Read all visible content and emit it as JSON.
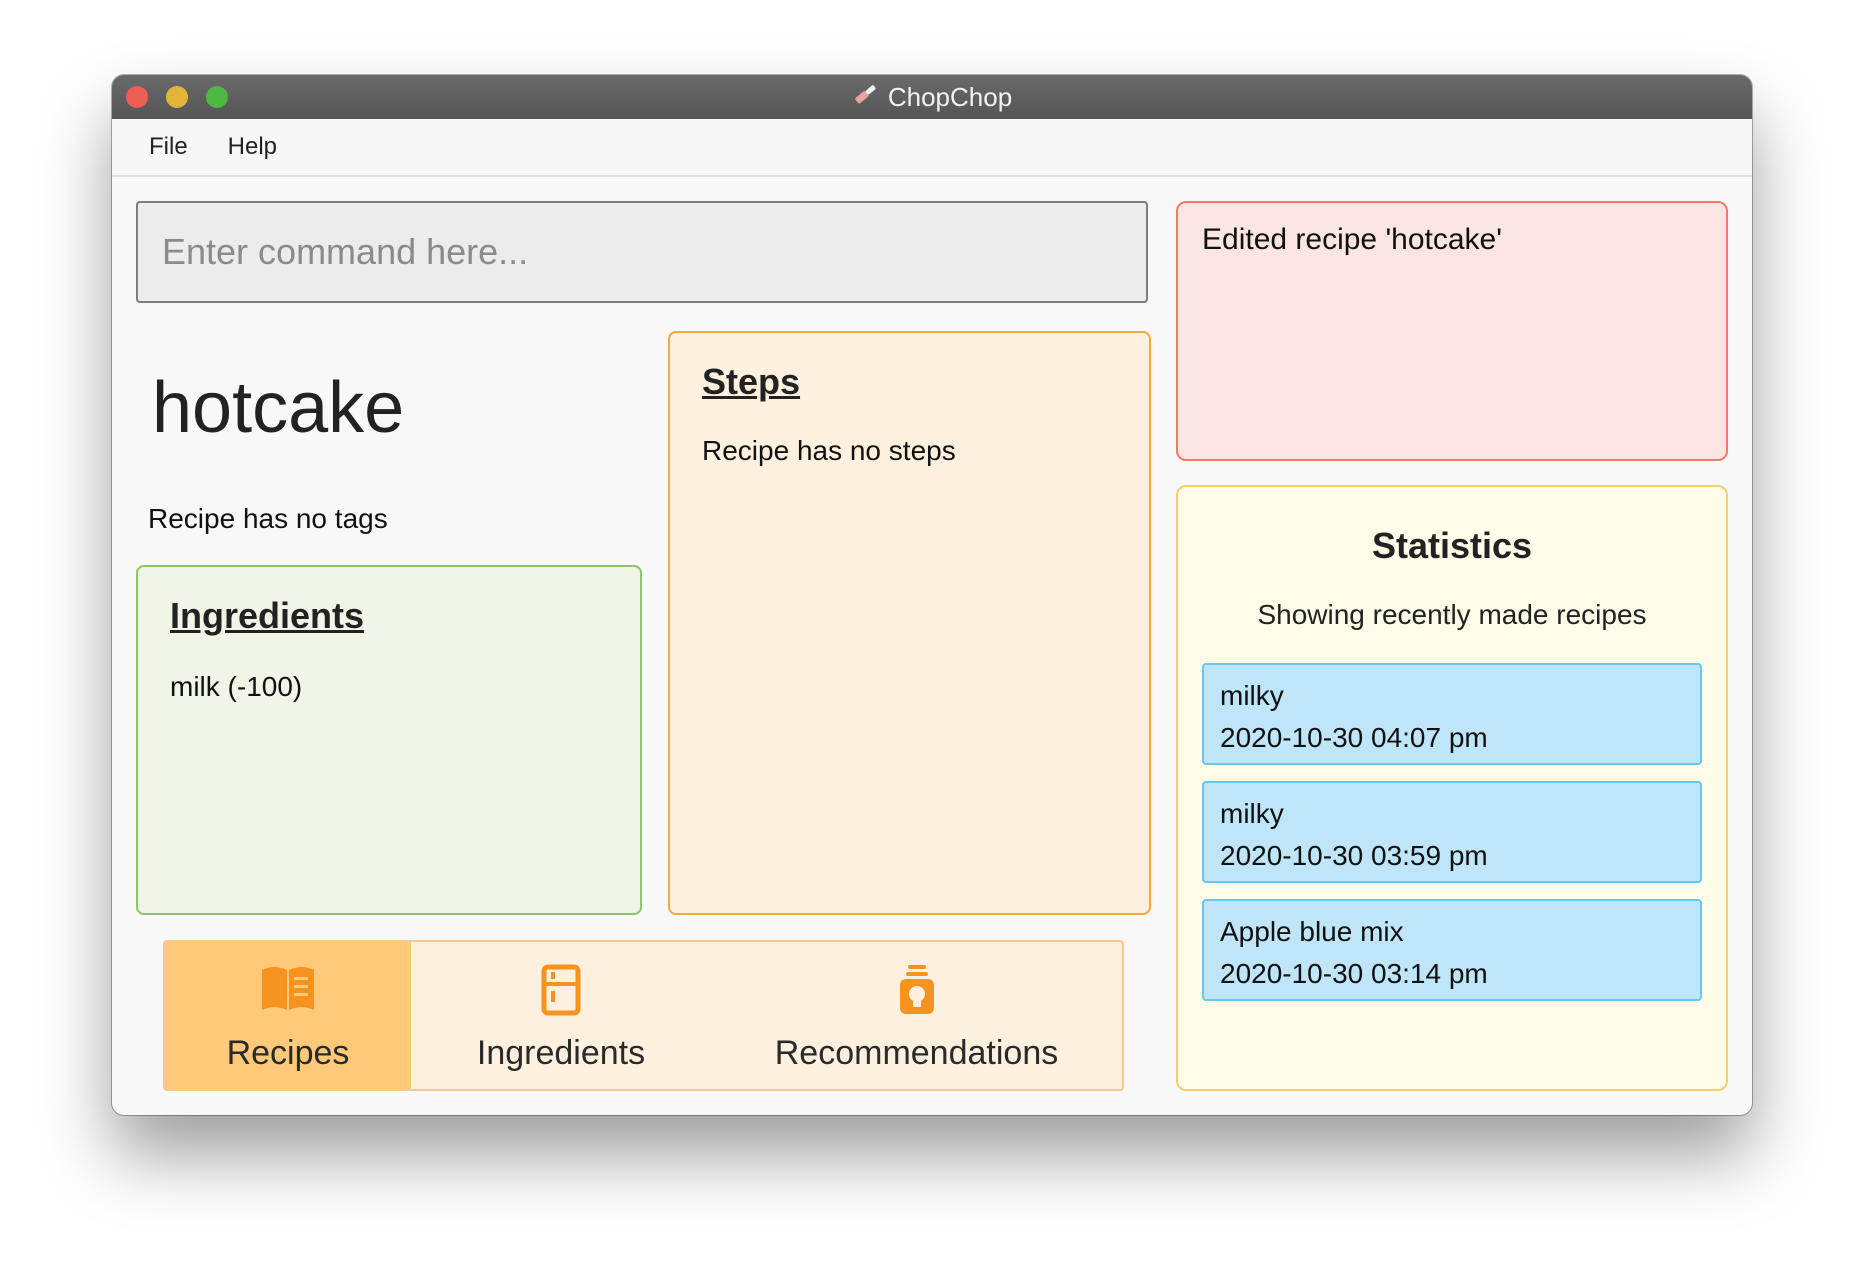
{
  "window": {
    "title": "ChopChop"
  },
  "menu": {
    "file": "File",
    "help": "Help"
  },
  "command": {
    "placeholder": "Enter command here...",
    "value": ""
  },
  "recipe": {
    "name": "hotcake",
    "tags_text": "Recipe has no tags",
    "ingredients_title": "Ingredients",
    "ingredients": [
      "milk (-100)"
    ],
    "steps_title": "Steps",
    "steps_text": "Recipe has no steps"
  },
  "tabs": [
    {
      "label": "Recipes",
      "icon": "book-icon",
      "active": true
    },
    {
      "label": "Ingredients",
      "icon": "fridge-icon",
      "active": false
    },
    {
      "label": "Recommendations",
      "icon": "lightbulb-icon",
      "active": false
    }
  ],
  "result": {
    "message": "Edited recipe 'hotcake'"
  },
  "statistics": {
    "title": "Statistics",
    "subtitle": "Showing recently made recipes",
    "entries": [
      {
        "name": "milky",
        "time": "2020-10-30 04:07 pm"
      },
      {
        "name": "milky",
        "time": "2020-10-30 03:59 pm"
      },
      {
        "name": "Apple blue mix",
        "time": "2020-10-30 03:14 pm"
      }
    ]
  },
  "colors": {
    "accent_orange": "#f5931e",
    "active_tab": "#ffc97a",
    "result_border": "#f07a66",
    "stat_card": "#bee5f8"
  }
}
